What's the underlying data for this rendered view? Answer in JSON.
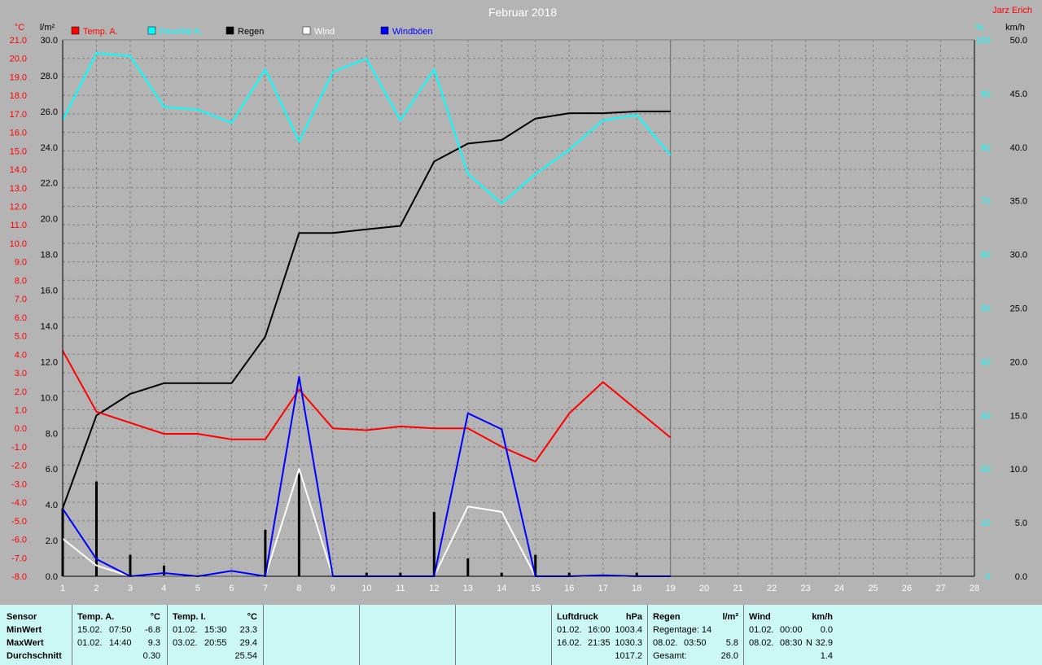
{
  "chart_data": {
    "type": "line",
    "title": "Februar 2018",
    "author": "Jarz Erich",
    "x_range": [
      1,
      28
    ],
    "x_ticks": [
      1,
      2,
      3,
      4,
      5,
      6,
      7,
      8,
      9,
      10,
      11,
      12,
      13,
      14,
      15,
      16,
      17,
      18,
      19,
      20,
      21,
      22,
      23,
      24,
      25,
      26,
      27,
      28
    ],
    "grid": true,
    "legend_position": "top",
    "axes": {
      "temp": {
        "unit": "°C",
        "ticks": [
          "21.0",
          "20.0",
          "19.0",
          "18.0",
          "17.0",
          "16.0",
          "15.0",
          "14.0",
          "13.0",
          "12.0",
          "11.0",
          "10.0",
          "9.0",
          "8.0",
          "7.0",
          "6.0",
          "5.0",
          "4.0",
          "3.0",
          "2.0",
          "1.0",
          "0.0",
          "-1.0",
          "-2.0",
          "-3.0",
          "-4.0",
          "-5.0",
          "-6.0",
          "-7.0",
          "-8.0"
        ],
        "color": "#ff0000"
      },
      "rain": {
        "unit": "l/m²",
        "range": [
          0,
          30
        ],
        "ticks": [
          "30.0",
          "28.0",
          "26.0",
          "24.0",
          "22.0",
          "20.0",
          "18.0",
          "16.0",
          "14.0",
          "12.0",
          "10.0",
          "8.0",
          "6.0",
          "4.0",
          "2.0",
          "0.0"
        ],
        "color": "#000000"
      },
      "humidity": {
        "unit": "%",
        "range": [
          0,
          100
        ],
        "ticks": [
          "100",
          "90",
          "80",
          "70",
          "60",
          "50",
          "40",
          "30",
          "20",
          "10",
          "0"
        ],
        "color": "#00ffff"
      },
      "wind": {
        "unit": "km/h",
        "range": [
          0,
          50
        ],
        "ticks": [
          "50.0",
          "45.0",
          "40.0",
          "35.0",
          "30.0",
          "25.0",
          "20.0",
          "15.0",
          "10.0",
          "5.0",
          "0.0"
        ],
        "color": "#000000"
      }
    },
    "series": [
      {
        "name": "Temp. A.",
        "color": "#ff0000",
        "axis": "temp",
        "x": [
          1,
          2,
          3,
          4,
          5,
          6,
          7,
          8,
          9,
          10,
          11,
          12,
          13,
          14,
          15,
          16,
          17,
          18,
          19
        ],
        "values": [
          4.2,
          0.9,
          0.3,
          -0.3,
          -0.3,
          -0.6,
          -0.6,
          2.1,
          0.0,
          -0.1,
          0.1,
          0.0,
          0.0,
          -1.0,
          -1.8,
          0.8,
          2.5,
          1.0,
          -0.5
        ]
      },
      {
        "name": "Feuchte A.",
        "color": "#00ffff",
        "axis": "humidity",
        "x": [
          1,
          2,
          3,
          4,
          5,
          6,
          7,
          8,
          9,
          10,
          11,
          12,
          13,
          14,
          15,
          16,
          17,
          18,
          19
        ],
        "values": [
          85,
          97.5,
          97,
          87.5,
          87,
          84.5,
          94.5,
          81,
          94,
          96.5,
          85,
          94.5,
          75,
          69.5,
          75,
          79.5,
          85,
          86,
          78.5
        ]
      },
      {
        "name": "Regen",
        "color": "#000000",
        "axis": "rain",
        "x": [
          1,
          2,
          3,
          4,
          5,
          6,
          7,
          8,
          9,
          10,
          11,
          12,
          13,
          14,
          15,
          16,
          17,
          18,
          19
        ],
        "values": [
          3.8,
          9.0,
          10.2,
          10.8,
          10.8,
          10.8,
          13.4,
          19.2,
          19.2,
          19.4,
          19.6,
          23.2,
          24.2,
          24.4,
          25.6,
          25.9,
          25.9,
          26.0,
          26.0
        ]
      },
      {
        "name": "Wind",
        "color": "#ffffff",
        "axis": "wind",
        "x": [
          1,
          2,
          3,
          4,
          5,
          6,
          7,
          8,
          9,
          10,
          11,
          12,
          13,
          14,
          15,
          16,
          17,
          18,
          19
        ],
        "values": [
          3.5,
          1.0,
          0.0,
          0.0,
          0.0,
          0.0,
          0.0,
          10.0,
          0.0,
          0.0,
          0.0,
          0.0,
          6.5,
          6.0,
          0.0,
          0.0,
          0.0,
          0.0,
          0.0
        ]
      },
      {
        "name": "Windböen",
        "color": "#0000ff",
        "axis": "wind",
        "x": [
          1,
          2,
          3,
          4,
          5,
          6,
          7,
          8,
          9,
          10,
          11,
          12,
          13,
          14,
          15,
          16,
          17,
          18,
          19
        ],
        "values": [
          6.3,
          1.6,
          0.0,
          0.3,
          0.0,
          0.5,
          0.0,
          18.6,
          0.0,
          0.0,
          0.0,
          0.0,
          15.2,
          13.7,
          0.0,
          0.0,
          0.1,
          0.0,
          0.0
        ]
      }
    ],
    "rain_bars": {
      "name": "Regen daily",
      "axis": "rain",
      "x": [
        1,
        2,
        3,
        4,
        5,
        6,
        7,
        8,
        9,
        10,
        11,
        12,
        13,
        14,
        15,
        16,
        17,
        18
      ],
      "values": [
        3.8,
        5.3,
        1.2,
        0.6,
        0.0,
        0.0,
        2.6,
        5.8,
        0.0,
        0.2,
        0.2,
        3.6,
        1.0,
        0.2,
        1.2,
        0.2,
        0.0,
        0.2
      ]
    }
  },
  "stats": {
    "sensor": {
      "head": "Sensor",
      "labels": [
        "MinWert",
        "MaxWert",
        "Durchschnitt"
      ]
    },
    "temp_a": {
      "name": "Temp. A.",
      "unit": "°C",
      "min_date": "15.02.",
      "min_time": "07:50",
      "min_val": "-6.8",
      "max_date": "01.02.",
      "max_time": "14:40",
      "max_val": "9.3",
      "avg": "0.30"
    },
    "temp_i": {
      "name": "Temp. I.",
      "unit": "°C",
      "min_date": "01.02.",
      "min_time": "15:30",
      "min_val": "23.3",
      "max_date": "03.02.",
      "max_time": "20:55",
      "max_val": "29.4",
      "avg": "25.54"
    },
    "luftdruck": {
      "name": "Luftdruck",
      "unit": "hPa",
      "min_date": "01.02.",
      "min_time": "16:00",
      "min_val": "1003.4",
      "max_date": "16.02.",
      "max_time": "21:35",
      "max_val": "1030.3",
      "avg": "1017.2"
    },
    "regen": {
      "name": "Regen",
      "unit": "l/m²",
      "days_label": "Regentage: 14",
      "max_date": "08.02.",
      "max_time": "03:50",
      "max_val": "5.8",
      "total_label": "Gesamt:",
      "total": "26.0"
    },
    "wind": {
      "name": "Wind",
      "unit": "km/h",
      "min_date": "01.02.",
      "min_time": "00:00",
      "min_val": "0.0",
      "max_date": "08.02.",
      "max_time": "08:30",
      "max_dir": "N",
      "max_val": "32.9",
      "avg": "1.4"
    }
  }
}
